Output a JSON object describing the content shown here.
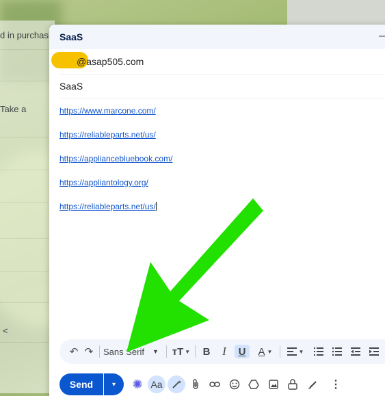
{
  "background_inbox": {
    "snippets": [
      "d in purchasin",
      "Take a",
      "<"
    ]
  },
  "compose": {
    "title": "SaaS",
    "minimize_icon": "minimize-icon",
    "to_email": "@asap505.com",
    "subject": "SaaS",
    "links": [
      "https://www.marcone.com/",
      "https://reliableparts.net/us/",
      "https://appliancebluebook.com/",
      "https://appliantology.org/",
      "https://reliableparts.net/us/"
    ]
  },
  "toolbar": {
    "undo": "↶",
    "redo": "↷",
    "font": "Sans Serif",
    "size": "ᴛT",
    "bold": "B",
    "italic": "I",
    "underline": "U",
    "text_color": "A"
  },
  "actions": {
    "send_label": "Send",
    "more_send_options": "▾",
    "format_options": "Aa"
  },
  "colors": {
    "send_blue": "#0b57d0",
    "arrow_green": "#22e000",
    "redaction_yellow": "#f6c200"
  }
}
